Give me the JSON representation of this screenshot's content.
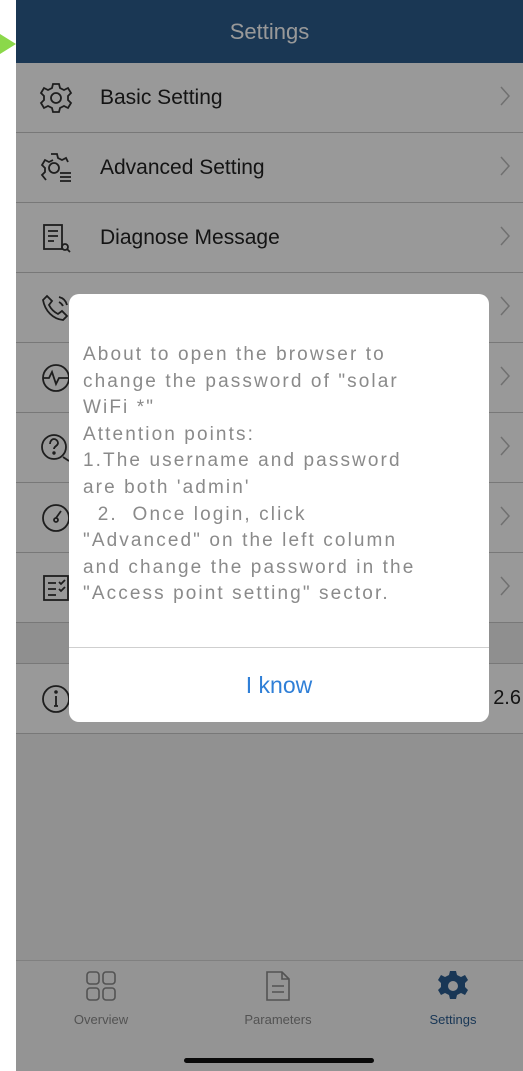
{
  "header": {
    "title": "Settings"
  },
  "menu": [
    {
      "label": "Basic Setting",
      "icon": "gear-icon"
    },
    {
      "label": "Advanced Setting",
      "icon": "gear-list-icon"
    },
    {
      "label": "Diagnose Message",
      "icon": "document-search-icon"
    },
    {
      "label": "",
      "icon": "phone-icon"
    },
    {
      "label": "",
      "icon": "waveform-icon"
    },
    {
      "label": "",
      "icon": "help-icon"
    },
    {
      "label": "",
      "icon": "speedometer-icon"
    },
    {
      "label": "",
      "icon": "checklist-icon"
    }
  ],
  "info_row": {
    "icon": "info-icon",
    "value": "2.6"
  },
  "dialog": {
    "lines": [
      "About to open the browser to",
      "change the password of \"solar",
      "WiFi *\"",
      "Attention points:",
      "1.The username and password",
      "are both 'admin'",
      "  2.  Once login, click",
      "\"Advanced\" on the left column",
      "and change the password in the",
      "\"Access point setting\" sector."
    ],
    "button": "I know"
  },
  "tabbar": {
    "tabs": [
      {
        "label": "Overview",
        "icon": "grid-icon",
        "active": false
      },
      {
        "label": "Parameters",
        "icon": "document-icon",
        "active": false
      },
      {
        "label": "Settings",
        "icon": "gear-icon",
        "active": true
      }
    ]
  },
  "colors": {
    "header": "#2c5c8c",
    "accent": "#2f7fd7",
    "active_tab": "#2b5d90"
  }
}
